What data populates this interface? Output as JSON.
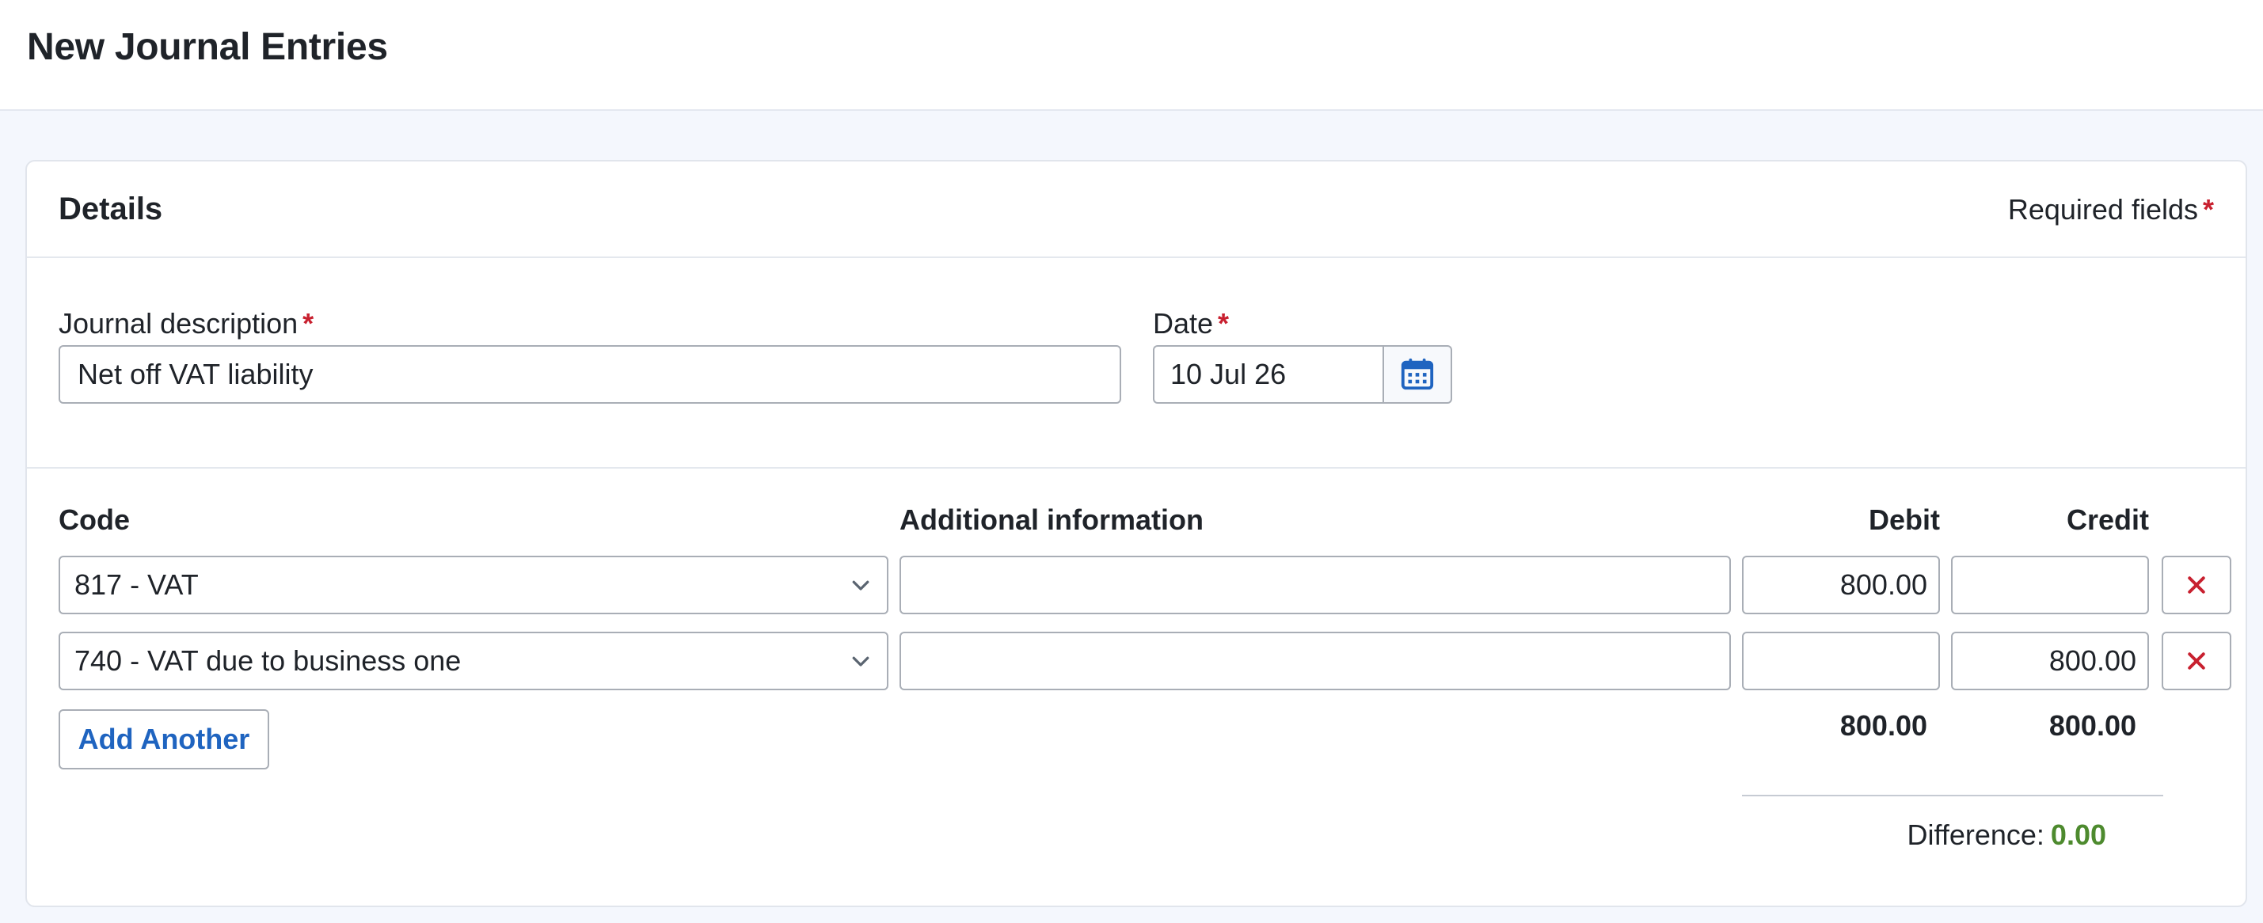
{
  "page": {
    "title": "New Journal Entries"
  },
  "details": {
    "section_title": "Details",
    "required_note": "Required fields",
    "required_marker": "*",
    "description_label": "Journal description",
    "description_value": "Net off VAT liability",
    "date_label": "Date",
    "date_value": "10 Jul 26"
  },
  "lines": {
    "headers": {
      "code": "Code",
      "additional": "Additional information",
      "debit": "Debit",
      "credit": "Credit"
    },
    "rows": [
      {
        "code": "817 - VAT",
        "additional": "",
        "debit": "800.00",
        "credit": ""
      },
      {
        "code": "740 - VAT due to business one",
        "additional": "",
        "debit": "",
        "credit": "800.00"
      }
    ],
    "add_label": "Add Another",
    "total_debit": "800.00",
    "total_credit": "800.00",
    "difference_label": "Difference:",
    "difference_value": "0.00"
  },
  "colors": {
    "accent": "#1f64c0",
    "required": "#c8202f",
    "remove": "#c8202f",
    "difference_ok": "#4d8a2e"
  },
  "icons": {
    "date_button": "calendar-icon",
    "select": "chevron-down-icon",
    "remove": "close-icon"
  }
}
